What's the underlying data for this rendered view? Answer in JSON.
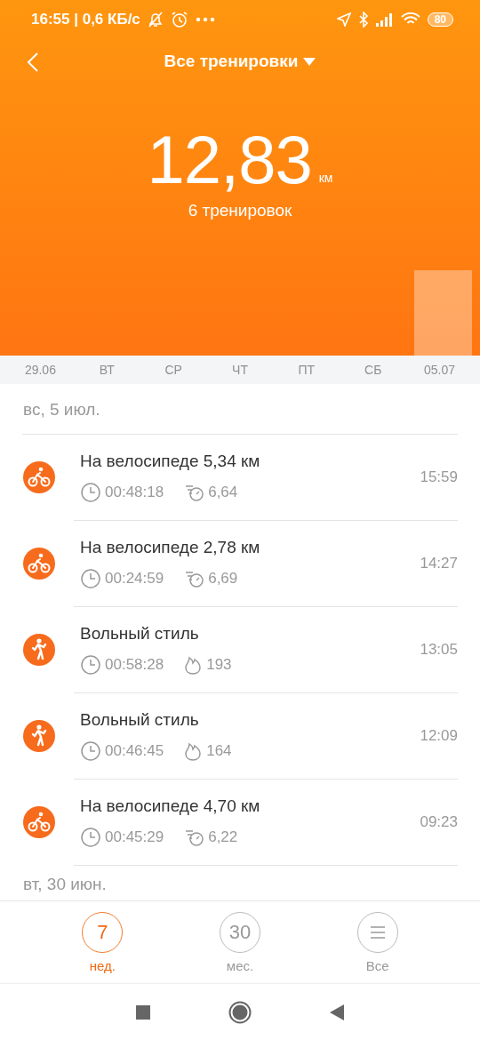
{
  "status_bar": {
    "time": "16:55 | 0,6 КБ/с",
    "battery": "80"
  },
  "header": {
    "title": "Все тренировки"
  },
  "summary": {
    "distance": "12,83",
    "unit": "км",
    "count": "6 тренировок"
  },
  "days": [
    "29.06",
    "ВТ",
    "СР",
    "ЧТ",
    "ПТ",
    "СБ",
    "05.07"
  ],
  "groups": [
    {
      "date": "вс, 5 июл.",
      "workouts": [
        {
          "kind": "cycling",
          "title": "На велосипеде 5,34 км",
          "stats": [
            {
              "kind": "duration",
              "value": "00:48:18"
            },
            {
              "kind": "pace",
              "value": "6,64"
            }
          ],
          "time": "15:59"
        },
        {
          "kind": "cycling",
          "title": "На велосипеде 2,78 км",
          "stats": [
            {
              "kind": "duration",
              "value": "00:24:59"
            },
            {
              "kind": "pace",
              "value": "6,69"
            }
          ],
          "time": "14:27"
        },
        {
          "kind": "freestyle",
          "title": "Вольный стиль",
          "stats": [
            {
              "kind": "duration",
              "value": "00:58:28"
            },
            {
              "kind": "calories",
              "value": "193"
            }
          ],
          "time": "13:05"
        },
        {
          "kind": "freestyle",
          "title": "Вольный стиль",
          "stats": [
            {
              "kind": "duration",
              "value": "00:46:45"
            },
            {
              "kind": "calories",
              "value": "164"
            }
          ],
          "time": "12:09"
        },
        {
          "kind": "cycling",
          "title": "На велосипеде 4,70 км",
          "stats": [
            {
              "kind": "duration",
              "value": "00:45:29"
            },
            {
              "kind": "pace",
              "value": "6,22"
            }
          ],
          "time": "09:23"
        }
      ]
    },
    {
      "date": "вт, 30 июн."
    }
  ],
  "tabs": [
    {
      "kind": "number",
      "label": "7",
      "caption": "нед.",
      "selected": true
    },
    {
      "kind": "number",
      "label": "30",
      "caption": "мес.",
      "selected": false
    },
    {
      "kind": "menu",
      "caption": "Все",
      "selected": false
    }
  ]
}
